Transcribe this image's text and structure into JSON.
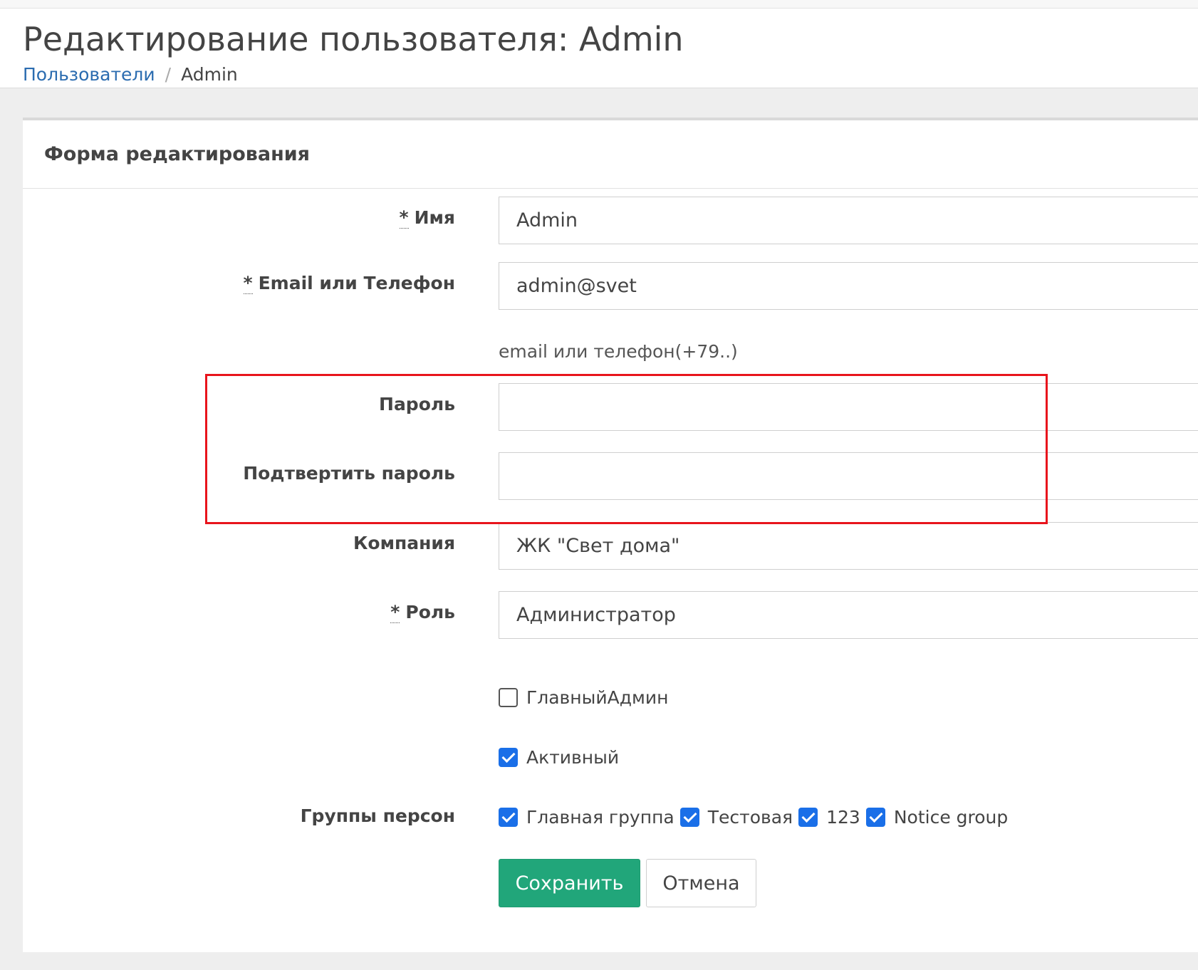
{
  "page": {
    "title": "Редактирование пользователя: Admin",
    "breadcrumb": {
      "parent": "Пользователи",
      "separator": "/",
      "current": "Admin"
    }
  },
  "form": {
    "heading": "Форма редактирования",
    "name": {
      "required": "*",
      "label": "Имя",
      "value": "Admin"
    },
    "email": {
      "required": "*",
      "label": "Email или Телефон",
      "value": "admin@svet",
      "hint": "email или телефон(+79..)"
    },
    "password": {
      "label": "Пароль",
      "value": ""
    },
    "password_confirm": {
      "label": "Подтвертить пароль",
      "value": ""
    },
    "company": {
      "label": "Компания",
      "value": "ЖК \"Свет дома\""
    },
    "role": {
      "required": "*",
      "label": "Роль",
      "value": "Администратор"
    },
    "main_admin": {
      "label": "ГлавныйАдмин",
      "checked": false
    },
    "active": {
      "label": "Активный",
      "checked": true
    },
    "groups": {
      "label": "Группы персон",
      "items": [
        {
          "label": "Главная группа",
          "checked": true
        },
        {
          "label": "Тестовая",
          "checked": true
        },
        {
          "label": "123",
          "checked": true
        },
        {
          "label": "Notice group",
          "checked": true
        }
      ]
    },
    "buttons": {
      "save": "Сохранить",
      "cancel": "Отмена"
    }
  },
  "colors": {
    "link": "#2b6cb0",
    "save_button": "#21a67a",
    "checkbox_checked": "#1a6fe8",
    "annotation": "#e8141c"
  }
}
